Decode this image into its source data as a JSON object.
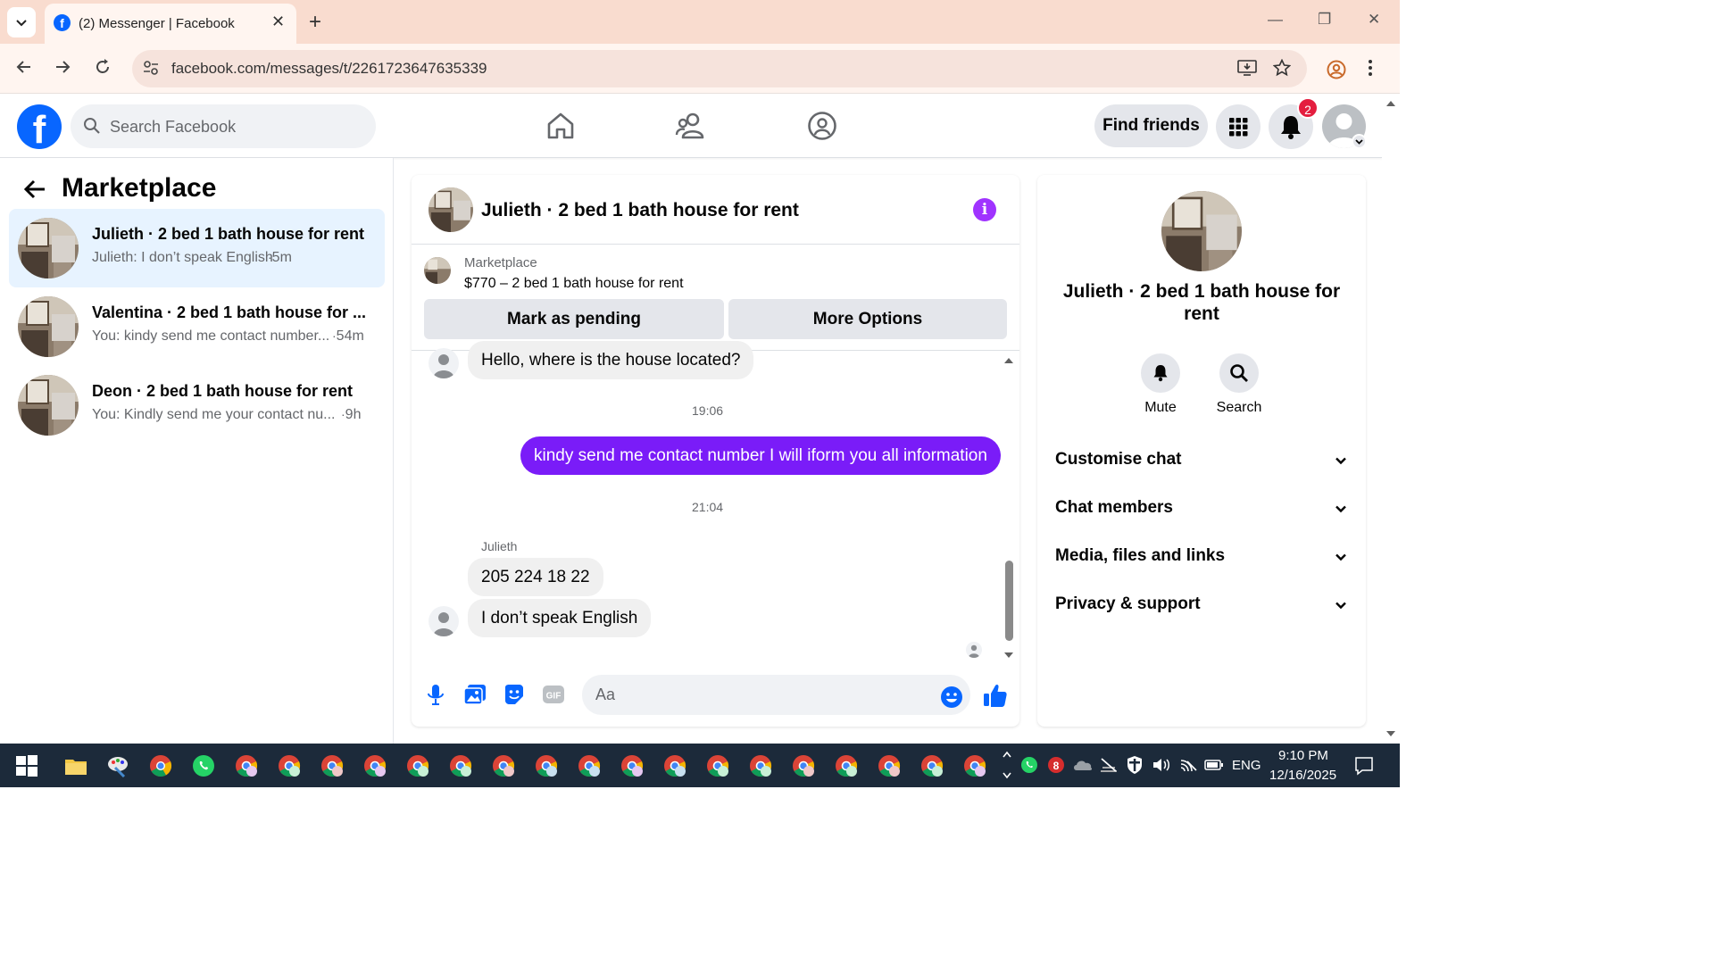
{
  "browser": {
    "tab_title": "(2) Messenger | Facebook",
    "url": "facebook.com/messages/t/2261723647635339"
  },
  "fb": {
    "search_placeholder": "Search Facebook",
    "find_friends_label": "Find friends",
    "notification_count": "2",
    "brand_color": "#0866ff"
  },
  "sidebar": {
    "title": "Marketplace",
    "conversations": [
      {
        "name": "Julieth · 2 bed 1 bath house for rent",
        "snippet": "Julieth: I don’t speak English",
        "time": "5m",
        "active": true
      },
      {
        "name": "Valentina · 2 bed 1 bath house for ...",
        "snippet": "You: kindy send me contact number...",
        "time": "54m",
        "active": false
      },
      {
        "name": "Deon · 2 bed 1 bath house for rent",
        "snippet": "You: Kindly send me your contact nu...",
        "time": "9h",
        "active": false
      }
    ]
  },
  "chat": {
    "title": "Julieth · 2 bed 1 bath house for rent",
    "listing": {
      "source": "Marketplace",
      "price_title": "$770 – 2 bed 1 bath house for rent",
      "mark_pending_label": "Mark as pending",
      "more_options_label": "More Options"
    },
    "messages": [
      {
        "from": "them",
        "text": "Hello, where is the house located?"
      },
      {
        "type": "time",
        "text": "19:06"
      },
      {
        "from": "me",
        "text": "kindy send me contact number I will iform you all information"
      },
      {
        "type": "time",
        "text": "21:04"
      },
      {
        "type": "sender",
        "text": "Julieth"
      },
      {
        "from": "them",
        "text": "205 224 18 22"
      },
      {
        "from": "them",
        "text": "I don’t speak English"
      }
    ],
    "composer_placeholder": "Aa",
    "accent_color": "#7a1cf8"
  },
  "details": {
    "name": "Julieth · 2 bed 1 bath house for rent",
    "actions": [
      {
        "label": "Mute",
        "icon": "bell-icon"
      },
      {
        "label": "Search",
        "icon": "search-icon"
      }
    ],
    "sections": [
      "Customise chat",
      "Chat members",
      "Media, files and links",
      "Privacy & support"
    ]
  },
  "taskbar": {
    "language": "ENG",
    "time": "9:10 PM",
    "date": "12/16/2025"
  }
}
